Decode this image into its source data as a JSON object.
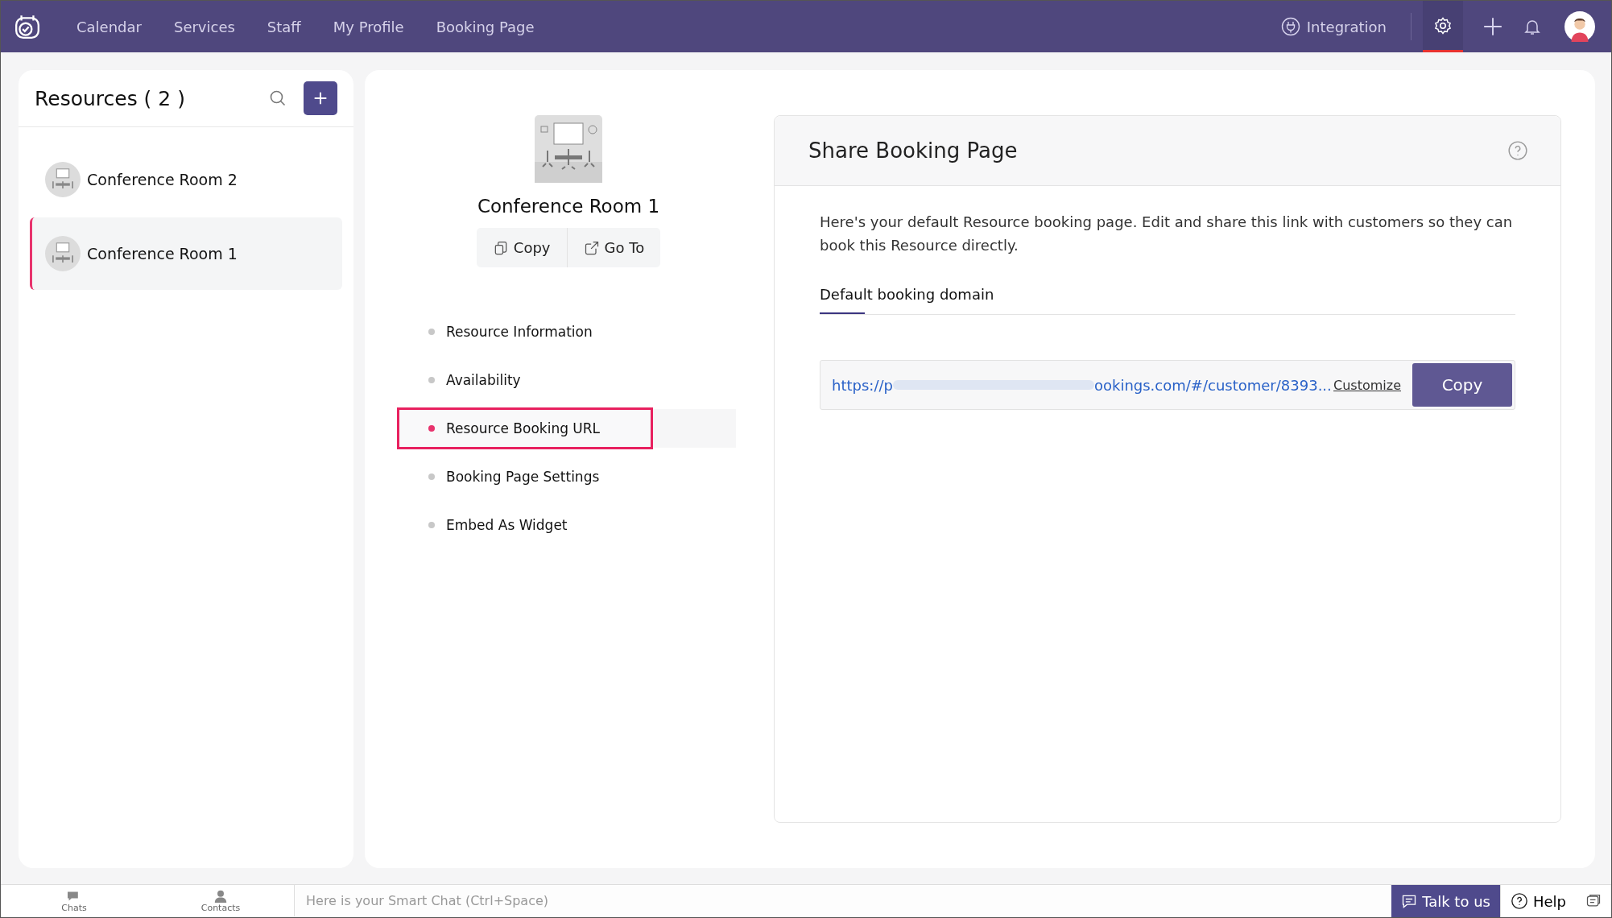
{
  "top_nav": {
    "items": [
      {
        "label": "Calendar",
        "selected": false
      },
      {
        "label": "Services",
        "selected": false
      },
      {
        "label": "Staff",
        "selected": false
      },
      {
        "label": "My Profile",
        "selected": false
      },
      {
        "label": "Booking Page",
        "selected": false
      }
    ],
    "integration": "Integration",
    "settings_selected": true
  },
  "resources": {
    "title": "Resources ( 2 )",
    "items": [
      {
        "name": "Conference Room 2",
        "selected": false
      },
      {
        "name": "Conference Room 1",
        "selected": true
      }
    ]
  },
  "detail": {
    "name": "Conference Room 1",
    "actions": [
      "Copy",
      "Go To"
    ],
    "menu": [
      {
        "label": "Resource Information",
        "selected": false
      },
      {
        "label": "Availability",
        "selected": false
      },
      {
        "label": "Resource Booking URL",
        "selected": true
      },
      {
        "label": "Booking Page Settings",
        "selected": false
      },
      {
        "label": "Embed As Widget",
        "selected": false
      }
    ]
  },
  "share": {
    "title": "Share Booking Page",
    "description": "Here's your default Resource booking page. Edit and share this link with customers so they can book this Resource directly.",
    "tabs": [
      {
        "label": "Default booking domain",
        "selected": true
      }
    ],
    "url_start": "https://p",
    "url_end": "ookings.com/#/customer/8393...",
    "customize": "Customize",
    "copy": "Copy"
  },
  "bottom_bar": {
    "chats": "Chats",
    "contacts": "Contacts",
    "chat_placeholder": "Here is your Smart Chat (Ctrl+Space)",
    "talk": "Talk to us",
    "help": "Help"
  }
}
